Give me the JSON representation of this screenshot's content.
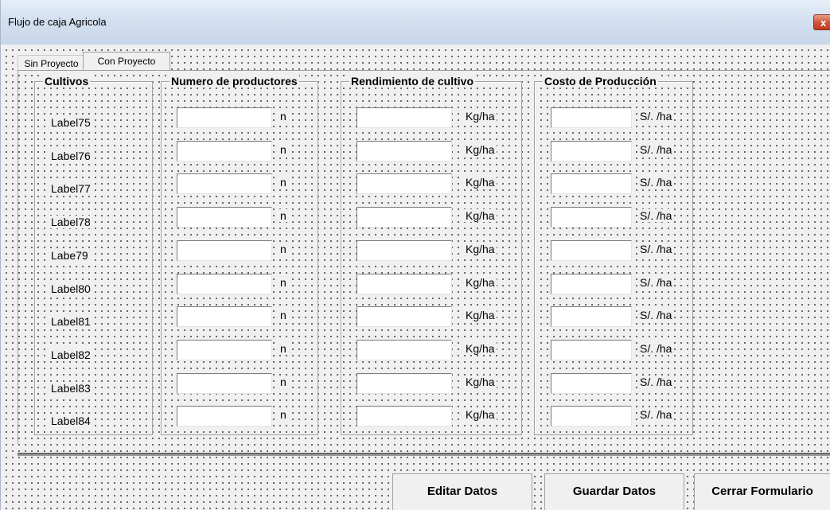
{
  "window": {
    "title": "Flujo de caja Agricola",
    "close_label": "x"
  },
  "tabs": [
    {
      "label": "Sin Proyecto",
      "active": false
    },
    {
      "label": "Con Proyecto",
      "active": true
    }
  ],
  "frames": {
    "cultivos": {
      "caption": "Cultivos"
    },
    "productores": {
      "caption": "Numero de productores",
      "unit": "n"
    },
    "rendimiento": {
      "caption": "Rendimiento de cultivo",
      "unit": "Kg/ha"
    },
    "costo": {
      "caption": "Costo de Producción",
      "unit": "S/. /ha"
    }
  },
  "crops": [
    "Label75",
    "Label76",
    "Label77",
    "Label78",
    "Labe79",
    "Label80",
    "Label81",
    "Label82",
    "Label83",
    "Label84"
  ],
  "buttons": {
    "edit": "Editar Datos",
    "save": "Guardar Datos",
    "close": "Cerrar Formulario"
  }
}
